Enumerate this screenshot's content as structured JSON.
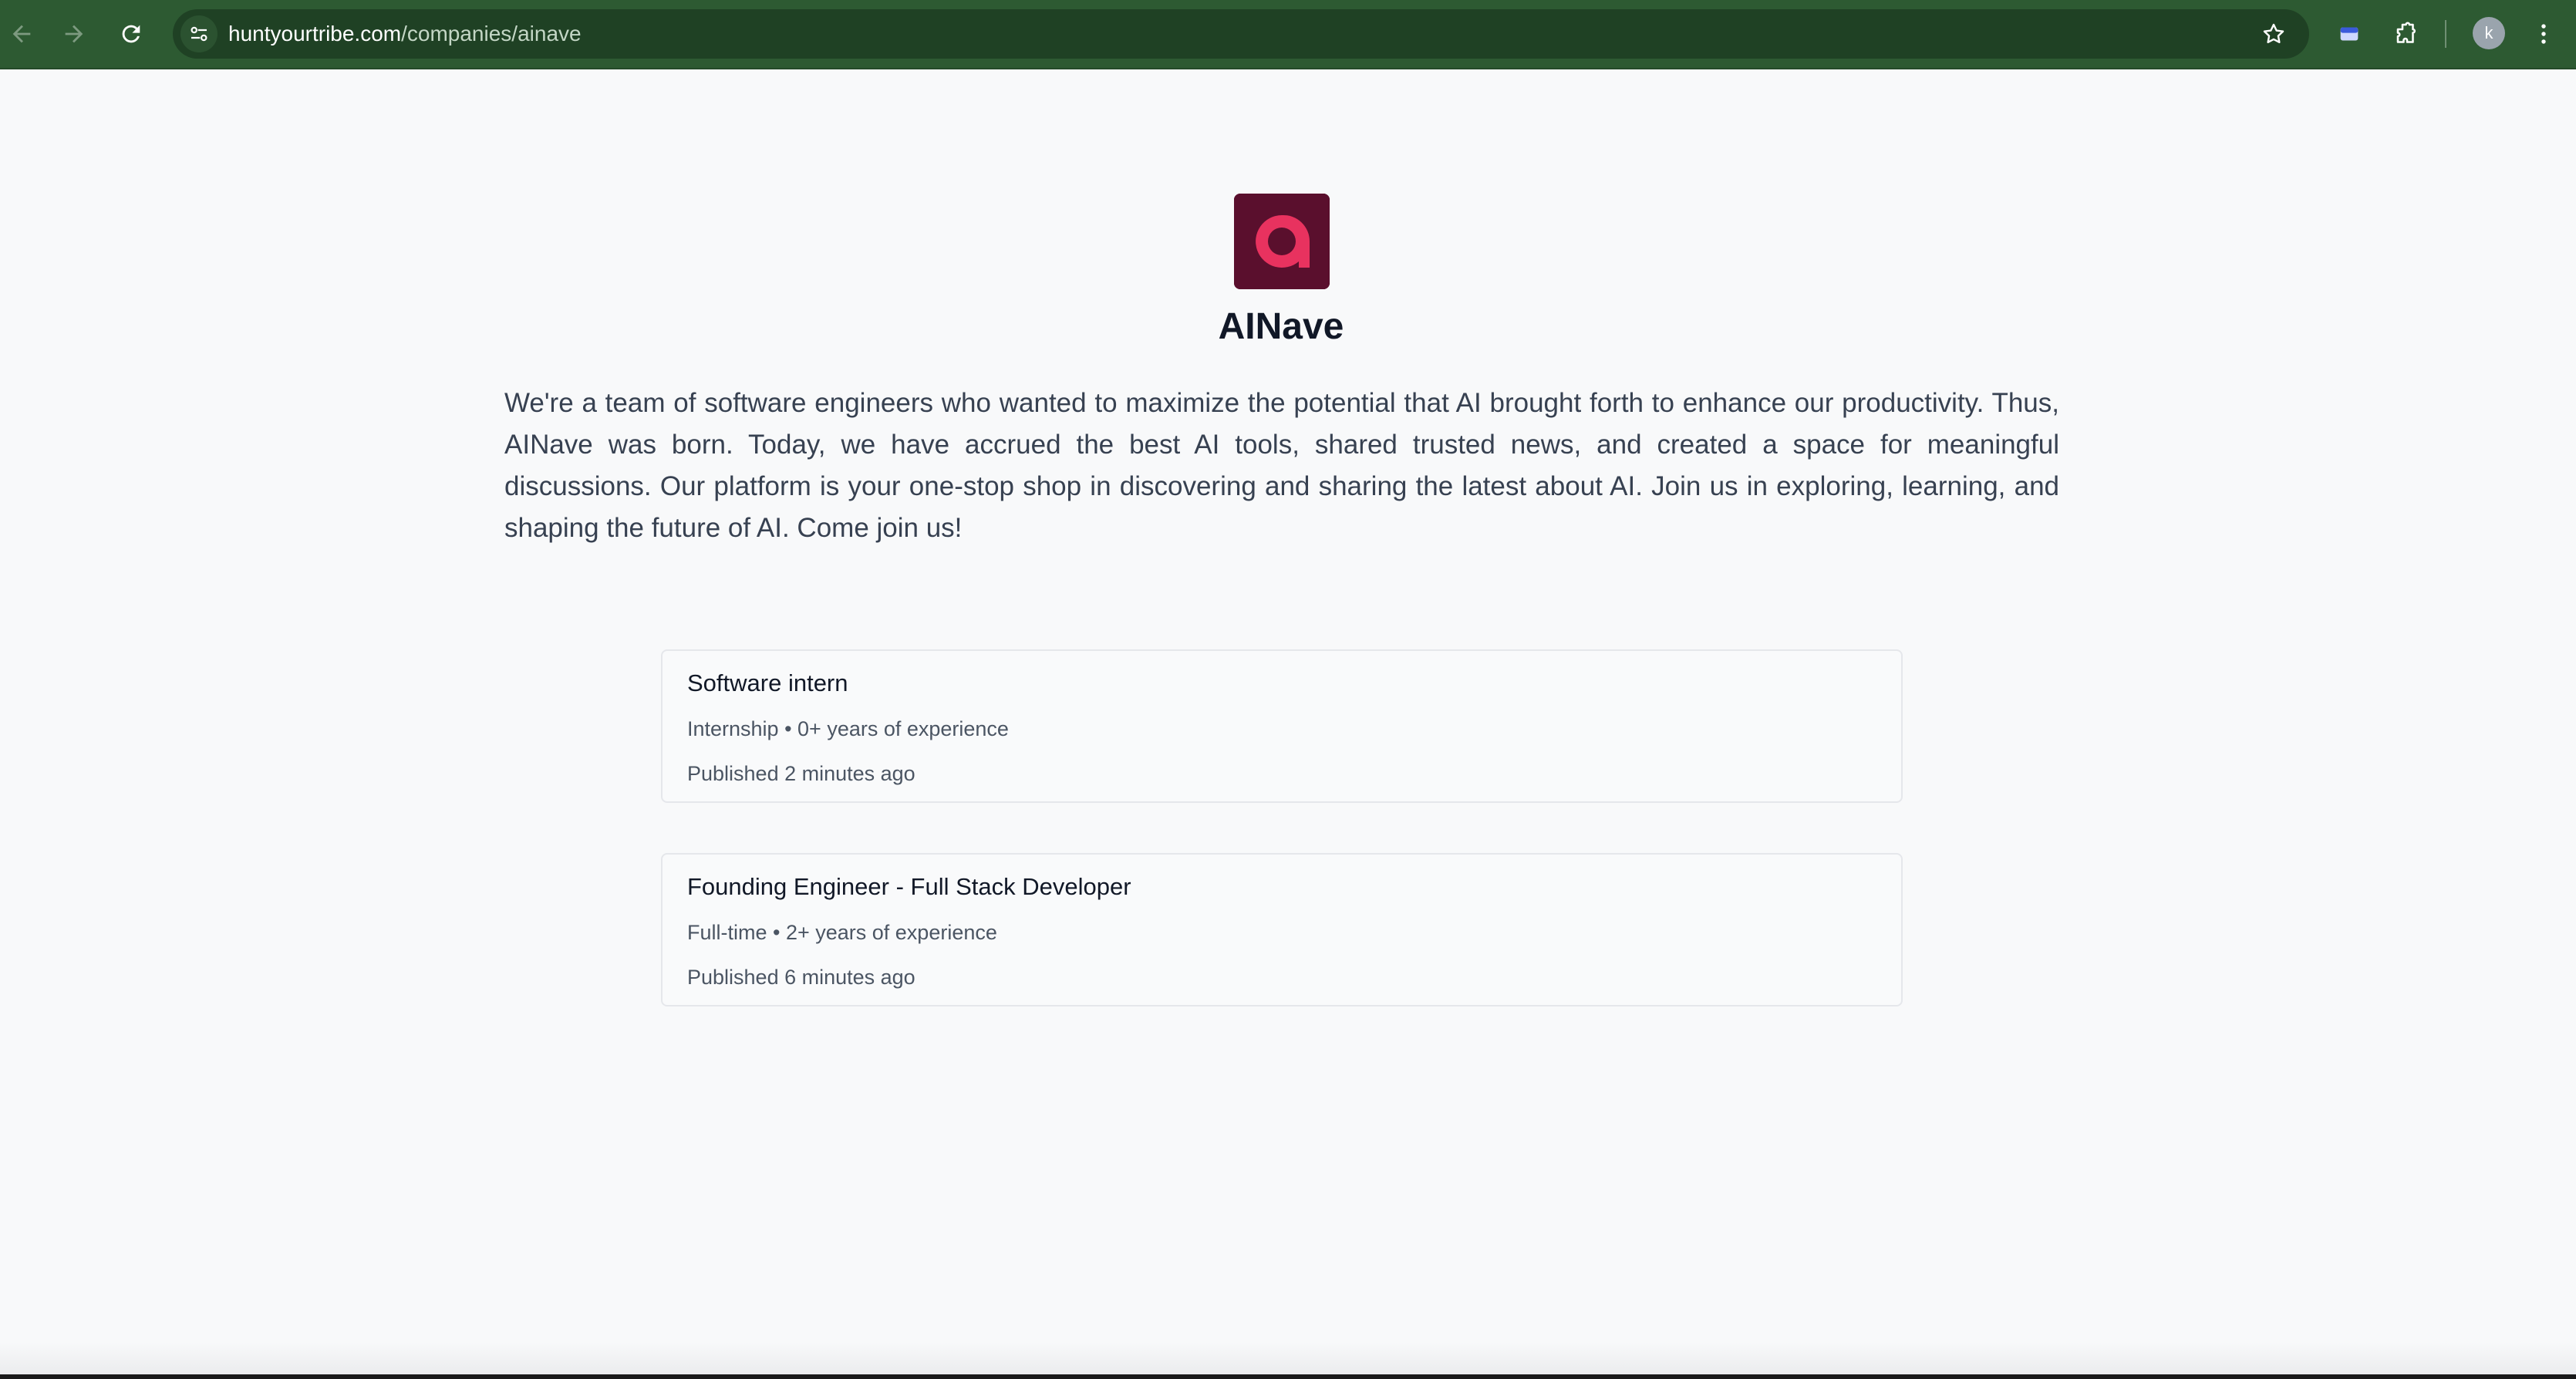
{
  "browser": {
    "url_host": "huntyourtribe.com",
    "url_path": "/companies/ainave",
    "profile_initial": "k",
    "icons": [
      "back-icon",
      "forward-icon",
      "reload-icon",
      "site-info-icon",
      "bookmark-star-icon",
      "tab-search-icon",
      "extensions-icon",
      "profile-avatar",
      "menu-icon"
    ],
    "theme_color": "#2d5a32"
  },
  "company": {
    "name": "AINave",
    "logo_letter": "a",
    "logo_color": "#5a0f2d",
    "logo_accent": "#e8325f",
    "description": "We're a team of software engineers who wanted to maximize the potential that AI brought forth to enhance our productivity. Thus, AINave was born. Today, we have accrued the best AI tools, shared trusted news, and created a space for meaningful discussions. Our platform is your one-stop shop in discovering and sharing the latest about AI. Join us in exploring, learning, and shaping the future of AI. Come join us!"
  },
  "jobs": [
    {
      "title": "Software intern",
      "meta": "Internship • 0+ years of experience",
      "published": "Published 2 minutes ago"
    },
    {
      "title": "Founding Engineer - Full Stack Developer",
      "meta": "Full-time • 2+ years of experience",
      "published": "Published 6 minutes ago"
    }
  ]
}
